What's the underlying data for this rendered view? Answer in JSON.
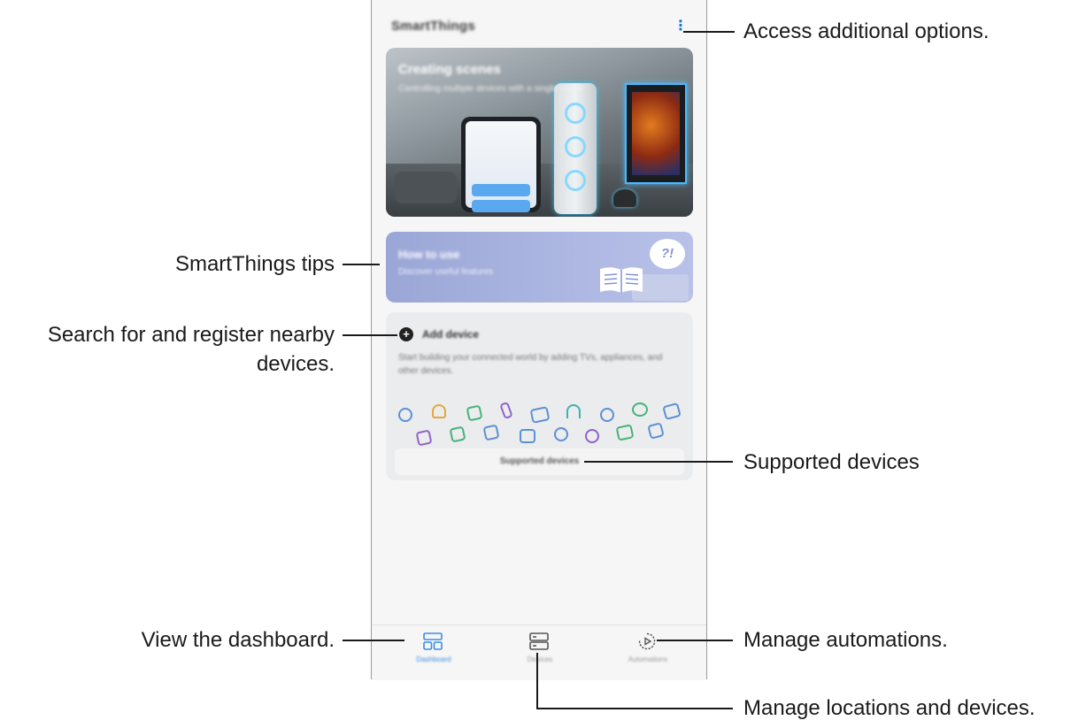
{
  "app": {
    "title": "SmartThings",
    "more_icon": "more-vertical-icon"
  },
  "scenes_card": {
    "title": "Creating scenes",
    "description": "Controlling multiple devices with a single scene"
  },
  "tips_card": {
    "title": "How to use",
    "description": "Discover useful features",
    "bubble_text": "?!"
  },
  "add_device_card": {
    "title": "Add device",
    "description": "Start building your connected world by adding TVs, appliances, and other devices.",
    "supported_button": "Supported devices",
    "device_icons": [
      "speaker",
      "bulb",
      "washer",
      "remote",
      "tv",
      "headphones",
      "robot-vacuum",
      "air-purifier",
      "oven",
      "camera",
      "fridge",
      "printer",
      "camera",
      "watch",
      "lock",
      "tv",
      "tablet"
    ]
  },
  "bottom_nav": {
    "tabs": [
      {
        "label": "Dashboard",
        "icon": "dashboard-icon",
        "active": true
      },
      {
        "label": "Devices",
        "icon": "devices-icon",
        "active": false
      },
      {
        "label": "Automations",
        "icon": "automations-icon",
        "active": false
      }
    ]
  },
  "annotations": {
    "options": "Access additional options.",
    "tips": "SmartThings tips",
    "search_line1": "Search for and register nearby",
    "search_line2": "devices.",
    "supported": "Supported devices",
    "dashboard": "View the dashboard.",
    "automations": "Manage automations.",
    "locations": "Manage locations and devices."
  },
  "colors": {
    "accent": "#3b8de0",
    "more_icon": "#1a73c6",
    "tips_bg": "#a6b1de"
  }
}
